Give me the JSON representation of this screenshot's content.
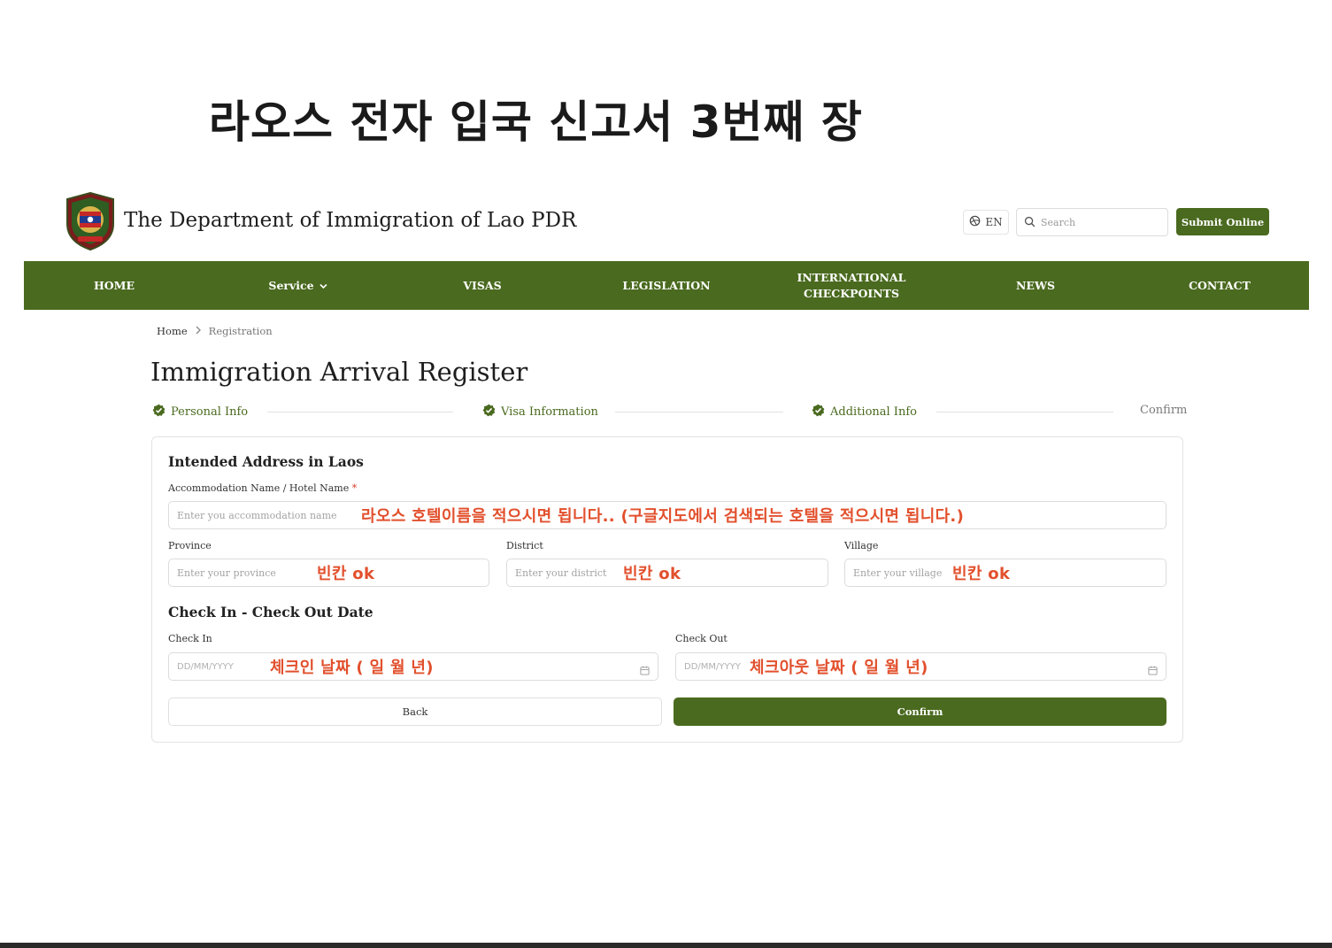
{
  "slide": {
    "title": "라오스 전자 입국 신고서 3번째 장"
  },
  "header": {
    "site_name": "The Department of Immigration of Lao PDR",
    "language": "EN",
    "search_placeholder": "Search",
    "submit_label": "Submit Online"
  },
  "nav": {
    "home": "HOME",
    "service": "Service",
    "visas": "VISAS",
    "legislation": "LEGISLATION",
    "intl_line1": "INTERNATIONAL",
    "intl_line2": "CHECKPOINTS",
    "news": "NEWS",
    "contact": "CONTACT"
  },
  "breadcrumb": {
    "home": "Home",
    "current": "Registration"
  },
  "page_title": "Immigration Arrival Register",
  "steps": [
    {
      "label": "Personal Info",
      "done": true
    },
    {
      "label": "Visa Information",
      "done": true
    },
    {
      "label": "Additional Info",
      "done": true
    },
    {
      "label": "Confirm",
      "done": false
    }
  ],
  "form": {
    "address_section": "Intended Address in Laos",
    "accommodation_label": "Accommodation Name / Hotel Name",
    "required_mark": "*",
    "accommodation_placeholder": "Enter you accommodation name",
    "province_label": "Province",
    "province_placeholder": "Enter your province",
    "district_label": "District",
    "district_placeholder": "Enter your district",
    "village_label": "Village",
    "village_placeholder": "Enter your village",
    "dates_section": "Check In - Check Out Date",
    "checkin_label": "Check In",
    "checkin_placeholder": "DD/MM/YYYY",
    "checkout_label": "Check Out",
    "checkout_placeholder": "DD/MM/YYYY",
    "back_label": "Back",
    "confirm_label": "Confirm"
  },
  "annotations": {
    "accommodation": "라오스 호텔이름을 적으시면 됩니다.. (구글지도에서 검색되는 호텔을 적으시면 됩니다.)",
    "province": "빈칸 ok",
    "district": "빈칸 ok",
    "village": "빈칸 ok",
    "checkin": "체크인 날짜 ( 일 월 년)",
    "checkout": "체크아웃  날짜 ( 일 월 년)"
  },
  "colors": {
    "primary": "#4a6a1f",
    "annotation": "#e2502d",
    "required": "#d83a2a"
  }
}
